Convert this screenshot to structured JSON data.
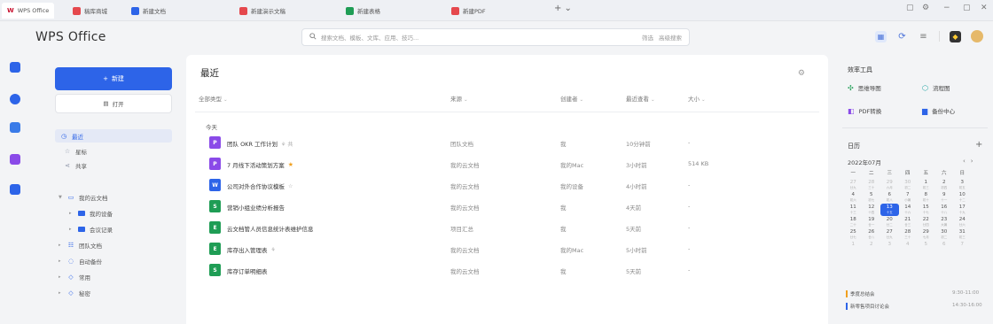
{
  "tabs": [
    {
      "label": "WPS Office",
      "color": "#c8102e",
      "active": true,
      "logo": "W"
    },
    {
      "label": "稿库商城",
      "color": "#e5484d"
    },
    {
      "label": "新建文档",
      "color": "#2d64e8"
    },
    {
      "label": "新建演示文稿",
      "color": "#e5484d"
    },
    {
      "label": "新建表格",
      "color": "#1f9d55"
    },
    {
      "label": "新建PDF",
      "color": "#e5484d"
    }
  ],
  "tab_add": "+ ⌄",
  "window": {
    "pin": "▢",
    "settings": "⚙",
    "minimize": "−",
    "maximize": "▢",
    "close": "✕"
  },
  "app_title": "WPS Office",
  "search": {
    "placeholder": "搜索文档、模板、文库、应用、技巧...",
    "chip1": "筛选",
    "chip2": "高级搜索"
  },
  "header_icons": {
    "grid": "▦",
    "sync": "⟳",
    "menu": "≡"
  },
  "rail_icons": [
    {
      "name": "doc-icon",
      "color": "#2d64e8"
    },
    {
      "name": "clock-icon",
      "color": "#2d64e8"
    },
    {
      "name": "team-icon",
      "color": "#2d64e8"
    },
    {
      "name": "apps-icon",
      "color": "#8a4ae8"
    },
    {
      "name": "box-icon",
      "color": "#2d64e8"
    }
  ],
  "nav": {
    "new_label": "新建",
    "open_label": "打开",
    "items": [
      {
        "icon": "◷",
        "label": "最近",
        "selected": true
      },
      {
        "icon": "☆",
        "label": "星标"
      },
      {
        "icon": "⋖",
        "label": "共享"
      }
    ],
    "tree": [
      {
        "label": "我的云文档",
        "icon": "▭"
      },
      {
        "label": "我的设备"
      },
      {
        "label": "会议记录"
      },
      {
        "label": "团队文档",
        "icon": "☷"
      },
      {
        "label": "自动备份",
        "icon": "◌"
      },
      {
        "label": "常用",
        "icon": "◇"
      },
      {
        "label": "秘密",
        "icon": "◇"
      }
    ]
  },
  "main": {
    "title": "最近",
    "columns": {
      "type": "全部类型",
      "source": "来源",
      "creator": "创建者",
      "viewed": "最近查看",
      "size": "大小"
    },
    "section": "今天",
    "rows": [
      {
        "icon": "P",
        "color": "#8a4ae8",
        "name": "团队 OKR 工作计划",
        "tag": "⚘ 共",
        "source": "团队文档",
        "creator": "我",
        "time": "10分钟前",
        "size": "-"
      },
      {
        "icon": "P",
        "color": "#8a4ae8",
        "name": "7 月线下活动策划方案",
        "star": "★",
        "source": "我的云文档",
        "creator": "我的Mac",
        "time": "3小时前",
        "size": "514 KB"
      },
      {
        "icon": "W",
        "color": "#2d64e8",
        "name": "公司对外合作协议模板",
        "tag": "☆",
        "source": "我的云文档",
        "creator": "我的设备",
        "time": "4小时前",
        "size": "-"
      },
      {
        "icon": "S",
        "color": "#1f9d55",
        "name": "营销小组业绩分析报告",
        "source": "我的云文档",
        "creator": "我",
        "time": "4天前",
        "size": "-"
      },
      {
        "icon": "E",
        "color": "#1f9d55",
        "name": "云文档管人员信息统计表维护信息",
        "source": "项目汇总",
        "creator": "我",
        "time": "5天前",
        "size": "-"
      },
      {
        "icon": "E",
        "color": "#1f9d55",
        "name": "库存出入管理表",
        "tag": "⚘",
        "source": "我的云文档",
        "creator": "我的Mac",
        "time": "5小时前",
        "size": "-"
      },
      {
        "icon": "S",
        "color": "#1f9d55",
        "name": "库存订单明细表",
        "source": "我的云文档",
        "creator": "我",
        "time": "5天前",
        "size": "-"
      }
    ]
  },
  "rpanel": {
    "tools_title": "效率工具",
    "tools": [
      {
        "icon": "✣",
        "color": "#1f9d55",
        "label": "思维导图"
      },
      {
        "icon": "⬡",
        "color": "#1fa3a3",
        "label": "流程图"
      },
      {
        "icon": "◧",
        "color": "#8a4ae8",
        "label": "PDF转换"
      },
      {
        "icon": "▆",
        "color": "#2d64e8",
        "label": "备份中心"
      }
    ],
    "calendar_title": "日历",
    "month": "2022年07月",
    "weekdays": [
      "一",
      "二",
      "三",
      "四",
      "五",
      "六",
      "日"
    ],
    "weeks": [
      [
        {
          "d": "27",
          "s": "廿九",
          "m": true
        },
        {
          "d": "28",
          "s": "三十",
          "m": true
        },
        {
          "d": "29",
          "s": "六月",
          "m": true
        },
        {
          "d": "30",
          "s": "初二",
          "m": true
        },
        {
          "d": "1",
          "s": "初三"
        },
        {
          "d": "2",
          "s": "初四"
        },
        {
          "d": "3",
          "s": "初五"
        }
      ],
      [
        {
          "d": "4",
          "s": "初六"
        },
        {
          "d": "5",
          "s": "初七"
        },
        {
          "d": "6",
          "s": "初八"
        },
        {
          "d": "7",
          "s": "小暑"
        },
        {
          "d": "8",
          "s": "初十"
        },
        {
          "d": "9",
          "s": "十一"
        },
        {
          "d": "10",
          "s": "十二"
        }
      ],
      [
        {
          "d": "11",
          "s": "十三"
        },
        {
          "d": "12",
          "s": "十四"
        },
        {
          "d": "13",
          "s": "十五",
          "t": true
        },
        {
          "d": "14",
          "s": "十六"
        },
        {
          "d": "15",
          "s": "十七"
        },
        {
          "d": "16",
          "s": "十八"
        },
        {
          "d": "17",
          "s": "十九"
        }
      ],
      [
        {
          "d": "18",
          "s": "二十"
        },
        {
          "d": "19",
          "s": "廿一"
        },
        {
          "d": "20",
          "s": "廿二"
        },
        {
          "d": "21",
          "s": "廿三"
        },
        {
          "d": "22",
          "s": "廿四"
        },
        {
          "d": "23",
          "s": "大暑"
        },
        {
          "d": "24",
          "s": "廿六"
        }
      ],
      [
        {
          "d": "25",
          "s": "廿七"
        },
        {
          "d": "26",
          "s": "廿八"
        },
        {
          "d": "27",
          "s": "廿九"
        },
        {
          "d": "28",
          "s": "三十"
        },
        {
          "d": "29",
          "s": "七月"
        },
        {
          "d": "30",
          "s": "初二"
        },
        {
          "d": "31",
          "s": "初三"
        }
      ],
      [
        {
          "d": "1",
          "s": "",
          "m": true
        },
        {
          "d": "2",
          "s": "",
          "m": true
        },
        {
          "d": "3",
          "s": "",
          "m": true
        },
        {
          "d": "4",
          "s": "",
          "m": true
        },
        {
          "d": "5",
          "s": "",
          "m": true
        },
        {
          "d": "6",
          "s": "",
          "m": true
        },
        {
          "d": "7",
          "s": "",
          "m": true
        }
      ]
    ],
    "events": [
      {
        "label": "季度总结会",
        "time": "9:30-11:00"
      },
      {
        "label": "新零售项目讨论会",
        "time": "14:30-16:00"
      }
    ]
  }
}
